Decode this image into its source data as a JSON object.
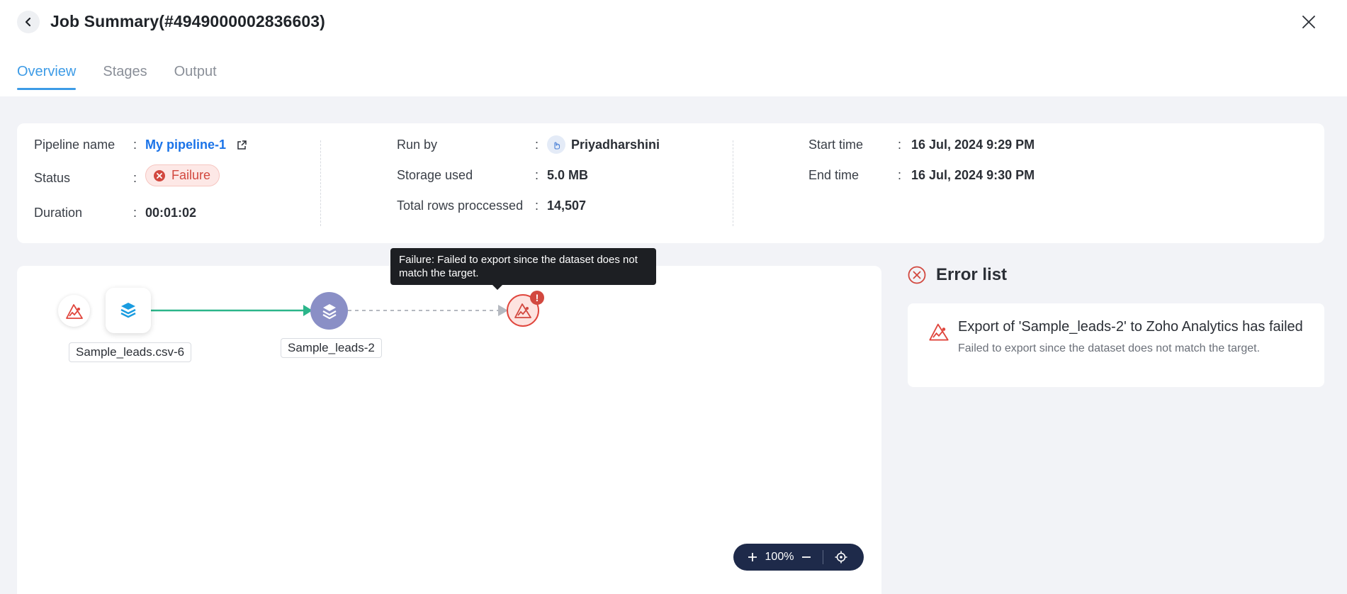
{
  "header": {
    "title": "Job Summary(#4949000002836603)",
    "tabs": [
      {
        "label": "Overview",
        "active": true
      },
      {
        "label": "Stages",
        "active": false
      },
      {
        "label": "Output",
        "active": false
      }
    ]
  },
  "summary": {
    "pipeline_label": "Pipeline name",
    "pipeline_value": "My pipeline-1",
    "status_label": "Status",
    "status_value": "Failure",
    "duration_label": "Duration",
    "duration_value": "00:01:02",
    "run_by_label": "Run by",
    "run_by_value": "Priyadharshini",
    "storage_label": "Storage used",
    "storage_value": "5.0 MB",
    "rows_label": "Total rows proccessed",
    "rows_value": "14,507",
    "start_label": "Start time",
    "start_value": "16 Jul, 2024 9:29 PM",
    "end_label": "End time",
    "end_value": "16 Jul, 2024 9:30 PM",
    "colon": ":"
  },
  "pipeline": {
    "source_node_label": "Sample_leads.csv-6",
    "dataset_node_label": "Sample_leads-2",
    "tooltip": "Failure: Failed to export since the dataset does not match the target.",
    "error_indicator": "!",
    "zoom_level": "100%"
  },
  "errors": {
    "title": "Error list",
    "items": [
      {
        "message": "Export of 'Sample_leads-2' to Zoho Analytics has failed",
        "detail": "Failed to export since the dataset does not match the target."
      }
    ]
  },
  "colors": {
    "accent": "#3d9be6",
    "link": "#1a73e8",
    "error": "#d2483f",
    "success_line": "#2bb58a",
    "dataset_node": "#8a8fc6",
    "zoom_bar": "#1e2a4a"
  }
}
